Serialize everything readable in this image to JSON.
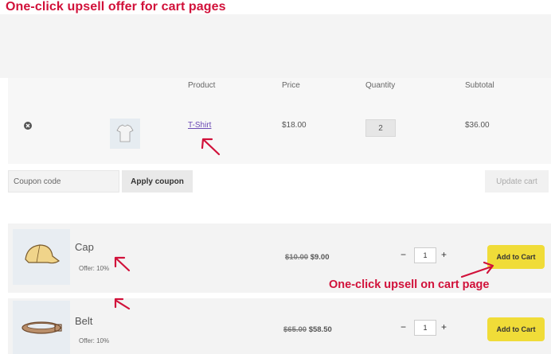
{
  "title": "One-click upsell offer for cart pages",
  "cart": {
    "headers": {
      "product": "Product",
      "price": "Price",
      "quantity": "Quantity",
      "subtotal": "Subtotal"
    },
    "item": {
      "name": "T-Shirt",
      "price": "$18.00",
      "quantity": "2",
      "subtotal": "$36.00"
    },
    "coupon_placeholder": "Coupon code",
    "apply_coupon": "Apply coupon",
    "update_cart": "Update cart"
  },
  "upsells": [
    {
      "name": "Cap",
      "offer": "Offer: 10%",
      "old_price": "$10.00",
      "new_price": "$9.00",
      "qty": "1",
      "add_label": "Add to Cart"
    },
    {
      "name": "Belt",
      "offer": "Offer: 10%",
      "old_price": "$65.00",
      "new_price": "$58.50",
      "qty": "1",
      "add_label": "Add to Cart"
    }
  ],
  "qty_minus": "−",
  "qty_plus": "+",
  "annotation": "One-click upsell on cart page",
  "colors": {
    "accent": "#d1113a",
    "button_yellow": "#f0dc38"
  }
}
